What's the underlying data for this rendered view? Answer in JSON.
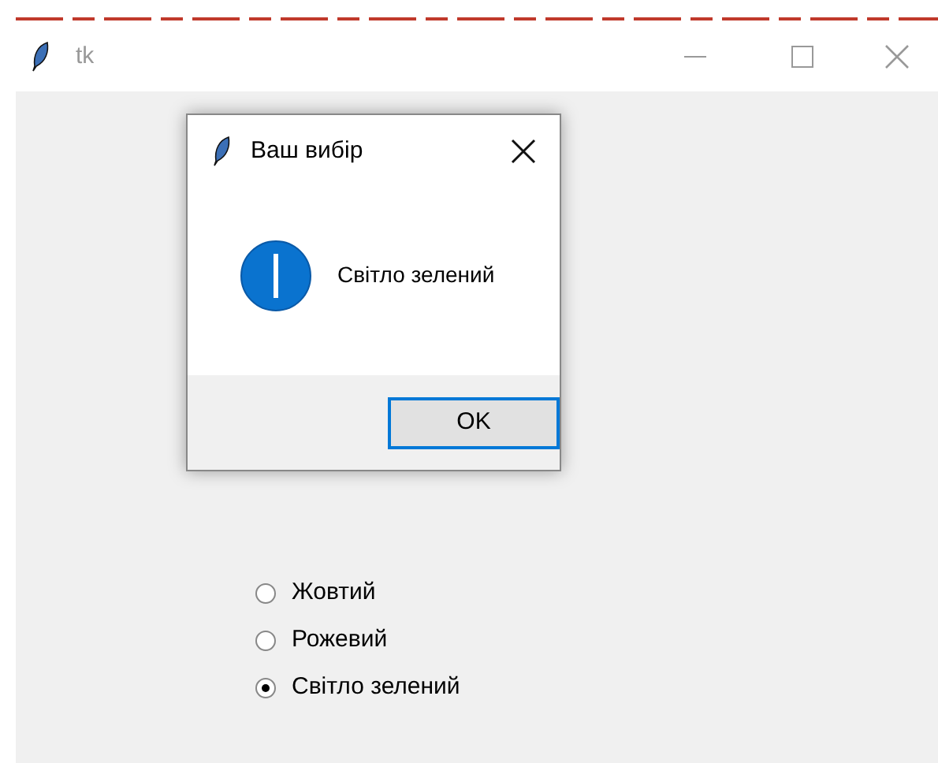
{
  "window": {
    "title": "tk"
  },
  "dialog": {
    "title": "Ваш вибір",
    "message": "Світло зелений",
    "buttons": [
      "OK"
    ]
  },
  "radios": [
    {
      "label": "Жовтий",
      "selected": false
    },
    {
      "label": "Рожевий",
      "selected": false
    },
    {
      "label": "Світло зелений",
      "selected": true
    }
  ]
}
